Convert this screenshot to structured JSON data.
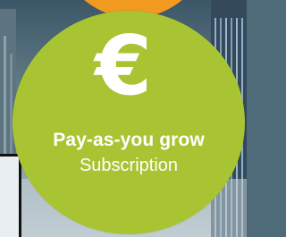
{
  "badge": {
    "icon": "euro-icon",
    "symbol": "€",
    "title": "Pay-as-you grow",
    "subtitle": "Subscription"
  },
  "colors": {
    "badge_green": "#a8c433",
    "accent_orange": "#f29a1f",
    "text": "#ffffff"
  }
}
